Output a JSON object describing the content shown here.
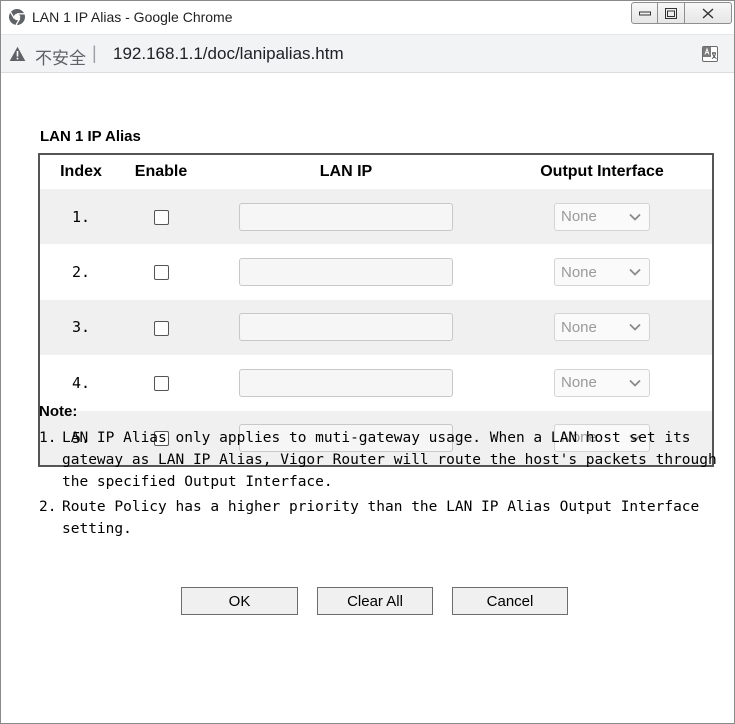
{
  "window": {
    "title": "LAN 1 IP Alias - Google Chrome"
  },
  "address_bar": {
    "security_label": "不安全",
    "separator": "|",
    "url": "192.168.1.1/doc/lanipalias.htm"
  },
  "page": {
    "section_title": "LAN 1 IP Alias",
    "table": {
      "headers": [
        "Index",
        "Enable",
        "LAN IP",
        "Output Interface"
      ],
      "rows": [
        {
          "index": "1.",
          "enabled": false,
          "lan_ip": "",
          "output_interface": "None"
        },
        {
          "index": "2.",
          "enabled": false,
          "lan_ip": "",
          "output_interface": "None"
        },
        {
          "index": "3.",
          "enabled": false,
          "lan_ip": "",
          "output_interface": "None"
        },
        {
          "index": "4.",
          "enabled": false,
          "lan_ip": "",
          "output_interface": "None"
        },
        {
          "index": "5.",
          "enabled": false,
          "lan_ip": "",
          "output_interface": "None"
        }
      ]
    },
    "note_title": "Note:",
    "notes": [
      {
        "num": "1.",
        "text": "LAN IP Alias only applies to muti-gateway usage. When a LAN host set its gateway as LAN IP Alias, Vigor Router will route the host's packets through the specified Output Interface."
      },
      {
        "num": "2.",
        "text": "Route Policy has a higher priority than the LAN IP Alias Output Interface setting."
      }
    ],
    "buttons": {
      "ok": "OK",
      "clear_all": "Clear All",
      "cancel": "Cancel"
    }
  }
}
